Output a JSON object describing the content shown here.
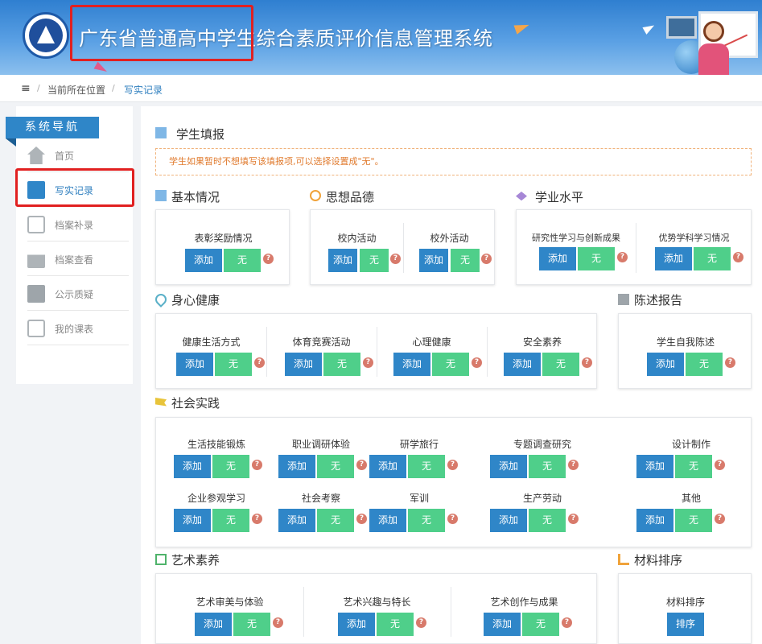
{
  "header": {
    "title": "广东省普通高中学生综合素质评价信息管理系统"
  },
  "breadcrumb": {
    "menu_icon": "≡",
    "location": "当前所在位置",
    "current": "写实记录"
  },
  "sidebar": {
    "title": "系统导航",
    "items": [
      {
        "label": "首页",
        "icon": "home-icon"
      },
      {
        "label": "写实记录",
        "icon": "edit-document-icon"
      },
      {
        "label": "档案补录",
        "icon": "swap-icon"
      },
      {
        "label": "档案查看",
        "icon": "archive-box-icon"
      },
      {
        "label": "公示质疑",
        "icon": "edit-document-icon"
      },
      {
        "label": "我的课表",
        "icon": "swap-icon"
      }
    ]
  },
  "main": {
    "student_fill_title": "学生填报",
    "notice": "学生如果暂时不想填写该填报项,可以选择设置成\"无\"。",
    "buttons": {
      "add": "添加",
      "none": "无",
      "sort": "排序",
      "help": "?"
    },
    "sections": {
      "basic": {
        "title": "基本情况",
        "items": [
          "表彰奖励情况"
        ]
      },
      "moral": {
        "title": "思想品德",
        "items": [
          "校内活动",
          "校外活动"
        ]
      },
      "academic": {
        "title": "学业水平",
        "items": [
          "研究性学习与创新成果",
          "优势学科学习情况"
        ]
      },
      "health": {
        "title": "身心健康",
        "items": [
          "健康生活方式",
          "体育竞赛活动",
          "心理健康",
          "安全素养"
        ]
      },
      "statement": {
        "title": "陈述报告",
        "items": [
          "学生自我陈述"
        ]
      },
      "social": {
        "title": "社会实践",
        "items": [
          "生活技能锻炼",
          "职业调研体验",
          "研学旅行",
          "专题调查研究",
          "设计制作",
          "企业参观学习",
          "社会考察",
          "军训",
          "生产劳动",
          "其他"
        ]
      },
      "art": {
        "title": "艺术素养",
        "items": [
          "艺术审美与体验",
          "艺术兴趣与特长",
          "艺术创作与成果"
        ]
      },
      "sorting": {
        "title": "材料排序",
        "items": [
          "材料排序"
        ]
      }
    }
  },
  "colors": {
    "primary": "#2f86c8",
    "success": "#4fcf8a",
    "help": "#d87a6b",
    "highlight": "#e12020"
  }
}
